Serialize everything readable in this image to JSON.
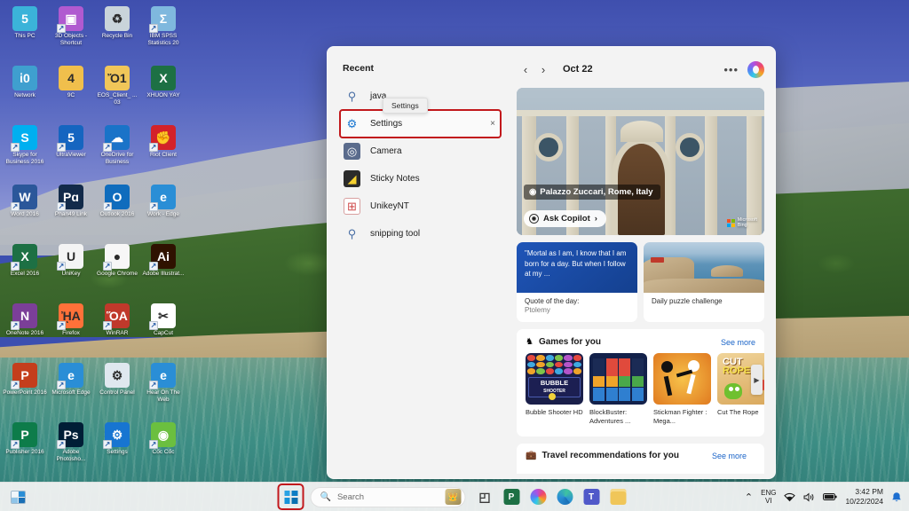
{
  "desktop": {
    "icons": [
      {
        "label": "This PC",
        "icon": "monitor-icon",
        "color": "#3bb3d9",
        "glyph": "὚5",
        "shortcut": false
      },
      {
        "label": "3D Objects - Shortcut",
        "icon": "3d-objects-icon",
        "color": "#b05ad0",
        "glyph": "▣",
        "shortcut": true
      },
      {
        "label": "Recycle Bin",
        "icon": "recycle-bin-icon",
        "color": "#c9d4da",
        "glyph": "♻",
        "shortcut": false
      },
      {
        "label": "IBM SPSS Statistics 20",
        "icon": "spss-icon",
        "color": "#7fb8de",
        "glyph": "Σ",
        "shortcut": true
      },
      {
        "label": "Network",
        "icon": "network-icon",
        "color": "#3f9fcf",
        "glyph": "ἱ0",
        "shortcut": false
      },
      {
        "label": "9C",
        "icon": "folder-user-icon",
        "color": "#f0bf4c",
        "glyph": "὆4",
        "shortcut": false
      },
      {
        "label": "EOS_Client_ ... 03",
        "icon": "folder-icon",
        "color": "#f0c659",
        "glyph": "Ὄ1",
        "shortcut": false
      },
      {
        "label": "XHUON YAY",
        "icon": "excel-file-icon",
        "color": "#1d7044",
        "glyph": "X",
        "shortcut": false
      },
      {
        "label": "Skype for Business 2016",
        "icon": "skype-icon",
        "color": "#00aff0",
        "glyph": "S",
        "shortcut": true
      },
      {
        "label": "UltraViewer",
        "icon": "ultraviewer-icon",
        "color": "#1565c0",
        "glyph": "὚5",
        "shortcut": true
      },
      {
        "label": "OneDrive for Business",
        "icon": "onedrive-icon",
        "color": "#1a73c8",
        "glyph": "☁",
        "shortcut": true
      },
      {
        "label": "Riot Client",
        "icon": "riot-client-icon",
        "color": "#d3222a",
        "glyph": "✊",
        "shortcut": true
      },
      {
        "label": "Word 2016",
        "icon": "word-icon",
        "color": "#2b579a",
        "glyph": "W",
        "shortcut": true
      },
      {
        "label": "Phan49 Link",
        "icon": "phan49-icon",
        "color": "#122a4a",
        "glyph": "Pɑ",
        "shortcut": true
      },
      {
        "label": "Outlook 2016",
        "icon": "outlook-icon",
        "color": "#0f6cbd",
        "glyph": "O",
        "shortcut": true
      },
      {
        "label": "Work - Edge",
        "icon": "edge-icon",
        "color": "#2a8ed6",
        "glyph": "e",
        "shortcut": true
      },
      {
        "label": "Excel 2016",
        "icon": "excel-icon",
        "color": "#1d7044",
        "glyph": "X",
        "shortcut": true
      },
      {
        "label": "UniKey",
        "icon": "unikey-icon",
        "color": "#f4f4f4",
        "glyph": "U",
        "shortcut": true
      },
      {
        "label": "Google Chrome",
        "icon": "chrome-icon",
        "color": "#f7f7f7",
        "glyph": "●",
        "shortcut": true
      },
      {
        "label": "Adobe Illustrat...",
        "icon": "illustrator-icon",
        "color": "#2f1200",
        "glyph": "Ai",
        "shortcut": true
      },
      {
        "label": "OneNote 2016",
        "icon": "onenote-icon",
        "color": "#7b3f98",
        "glyph": "N",
        "shortcut": true
      },
      {
        "label": "Firefox",
        "icon": "firefox-icon",
        "color": "#ff7139",
        "glyph": "ᾘA",
        "shortcut": true
      },
      {
        "label": "WinRAR",
        "icon": "winrar-icon",
        "color": "#c0392b",
        "glyph": "ὍA",
        "shortcut": true
      },
      {
        "label": "CapCut",
        "icon": "capcut-icon",
        "color": "#ffffff",
        "glyph": "✂",
        "shortcut": true
      },
      {
        "label": "PowerPoint 2016",
        "icon": "powerpoint-icon",
        "color": "#c43e1c",
        "glyph": "P",
        "shortcut": true
      },
      {
        "label": "Microsoft Edge",
        "icon": "edge-icon",
        "color": "#2a8ed6",
        "glyph": "e",
        "shortcut": true
      },
      {
        "label": "Control Panel",
        "icon": "control-panel-icon",
        "color": "#dfe8ef",
        "glyph": "⚙",
        "shortcut": false
      },
      {
        "label": "Hear On The Web",
        "icon": "edge-icon",
        "color": "#2a8ed6",
        "glyph": "e",
        "shortcut": true
      },
      {
        "label": "Publisher 2016",
        "icon": "publisher-icon",
        "color": "#0d7c4a",
        "glyph": "P",
        "shortcut": true
      },
      {
        "label": "Adobe Photosho...",
        "icon": "photoshop-icon",
        "color": "#001e36",
        "glyph": "Ps",
        "shortcut": true
      },
      {
        "label": "Settings",
        "icon": "settings-gear-icon",
        "color": "#1775d1",
        "glyph": "⚙",
        "shortcut": true
      },
      {
        "label": "Cốc Cốc",
        "icon": "coccoc-icon",
        "color": "#6bbf3f",
        "glyph": "◉",
        "shortcut": true
      }
    ]
  },
  "flyout": {
    "recent": {
      "title": "Recent",
      "tooltip": "Settings",
      "items": [
        {
          "label": "java",
          "icon": "search-icon",
          "selected": false,
          "closable": false
        },
        {
          "label": "Settings",
          "icon": "settings-gear-icon",
          "selected": true,
          "closable": true,
          "close_glyph": "×"
        },
        {
          "label": "Camera",
          "icon": "camera-icon",
          "selected": false,
          "closable": false
        },
        {
          "label": "Sticky Notes",
          "icon": "sticky-notes-icon",
          "selected": false,
          "closable": false
        },
        {
          "label": "UnikeyNT",
          "icon": "unikey-icon",
          "selected": false,
          "closable": false
        },
        {
          "label": "snipping tool",
          "icon": "search-icon",
          "selected": false,
          "closable": false
        }
      ]
    },
    "feed": {
      "prev_glyph": "‹",
      "next_glyph": "›",
      "date": "Oct 22",
      "more_glyph": "•••",
      "copilot_label": "copilot-icon",
      "hero": {
        "location": "Palazzo Zuccari, Rome, Italy",
        "pin_glyph": "◉",
        "ask_copilot": "Ask Copilot",
        "ask_chevron": "›",
        "bing_line1": "Microsoft",
        "bing_line2": "Bing"
      },
      "quote_card": {
        "text": "\"Mortal as I am, I know that I am born for a day. But when I follow at my ...",
        "caption": "Quote of the day:",
        "author": "Ptolemy"
      },
      "puzzle_card": {
        "caption": "Daily puzzle challenge"
      },
      "games": {
        "icon": "games-controller-icon",
        "title": "Games for you",
        "see_more": "See more",
        "scroll_glyph": "▶",
        "items": [
          {
            "name": "Bubble Shooter HD",
            "art": "bubble-shooter"
          },
          {
            "name": "BlockBuster: Adventures ...",
            "art": "blockbuster"
          },
          {
            "name": "Stickman Fighter : Mega...",
            "art": "stickman"
          },
          {
            "name": "Cut The Rope",
            "art": "cut-the-rope"
          }
        ]
      },
      "travel": {
        "icon": "suitcase-icon",
        "title": "Travel recommendations for you",
        "see_more": "See more"
      }
    }
  },
  "taskbar": {
    "widgets_icon": "widgets-weather-icon",
    "start_label": "start-button",
    "search": {
      "placeholder": "Search",
      "icon": "search-icon",
      "avatar": "user-avatar"
    },
    "apps": [
      {
        "name": "task-view",
        "glyph": "◰",
        "color": "#4a4a4a"
      },
      {
        "name": "powerpoint",
        "glyph": "P",
        "color": "#1d7044"
      },
      {
        "name": "copilot",
        "glyph": "◕",
        "color": "#b14ee0"
      },
      {
        "name": "microsoft-edge",
        "glyph": "e",
        "color": "#2a8ed6"
      },
      {
        "name": "microsoft-teams",
        "glyph": "T",
        "color": "#5059c9"
      },
      {
        "name": "file-explorer",
        "glyph": "Ὄ1",
        "color": "#f0c659"
      }
    ],
    "tray": {
      "chevron_glyph": "⌃",
      "lang_line1": "ENG",
      "lang_line2": "VI",
      "wifi_glyph": "◠",
      "volume_glyph": "ὐA",
      "battery_glyph": "▭",
      "time": "3:42 PM",
      "date": "10/22/2024",
      "notification_glyph": "ὑ4"
    }
  },
  "colors": {
    "accent": "#1a64c8",
    "highlight_box": "#c2181c",
    "panel_bg": "#f3f3f3",
    "quote_bg": "#1f55b8"
  }
}
